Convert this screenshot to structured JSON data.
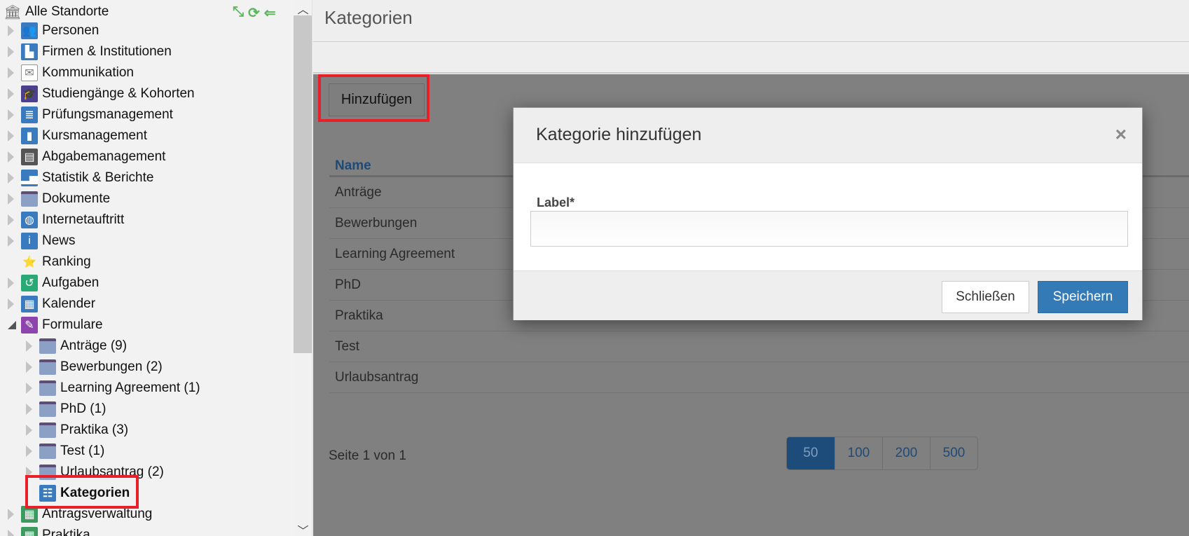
{
  "sidebar": {
    "root": "Alle Standorte",
    "items": [
      {
        "label": "Personen",
        "icon": "persons-icon",
        "color": "#3a7abf",
        "glyph": "👥",
        "level": 0,
        "arrow": "closed"
      },
      {
        "label": "Firmen & Institutionen",
        "icon": "factory-icon",
        "color": "#3a7abf",
        "glyph": "▙",
        "level": 0,
        "arrow": "closed"
      },
      {
        "label": "Kommunikation",
        "icon": "envelope-icon",
        "color": "#ffffff",
        "glyph": "✉",
        "level": 0,
        "arrow": "closed"
      },
      {
        "label": "Studiengänge & Kohorten",
        "icon": "graduation-cap-icon",
        "color": "#4b3f8f",
        "glyph": "🎓",
        "level": 0,
        "arrow": "closed"
      },
      {
        "label": "Prüfungsmanagement",
        "icon": "exam-chart-icon",
        "color": "#3a7abf",
        "glyph": "≣",
        "level": 0,
        "arrow": "closed"
      },
      {
        "label": "Kursmanagement",
        "icon": "book-icon",
        "color": "#3a7abf",
        "glyph": "▮",
        "level": 0,
        "arrow": "closed"
      },
      {
        "label": "Abgabemanagement",
        "icon": "id-card-icon",
        "color": "#555555",
        "glyph": "▤",
        "level": 0,
        "arrow": "closed"
      },
      {
        "label": "Statistik & Berichte",
        "icon": "bar-chart-icon",
        "color": "#3a7abf",
        "glyph": "▂▅",
        "level": 0,
        "arrow": "closed"
      },
      {
        "label": "Dokumente",
        "icon": "folder-icon",
        "color": "#8c9fc4",
        "glyph": "",
        "level": 0,
        "arrow": "closed",
        "folder": true
      },
      {
        "label": "Internetauftritt",
        "icon": "globe-icon",
        "color": "#3a7abf",
        "glyph": "◍",
        "level": 0,
        "arrow": "closed"
      },
      {
        "label": "News",
        "icon": "info-icon",
        "color": "#3a7abf",
        "glyph": "i",
        "level": 0,
        "arrow": "closed"
      },
      {
        "label": "Ranking",
        "icon": "star-medal-icon",
        "color": "#f2f2f2",
        "glyph": "⭐",
        "level": 0,
        "arrow": "none"
      },
      {
        "label": "Aufgaben",
        "icon": "history-clock-icon",
        "color": "#2aa876",
        "glyph": "↺",
        "level": 0,
        "arrow": "closed"
      },
      {
        "label": "Kalender",
        "icon": "calendar-icon",
        "color": "#3a7abf",
        "glyph": "▦",
        "level": 0,
        "arrow": "closed"
      },
      {
        "label": "Formulare",
        "icon": "form-wand-icon",
        "color": "#8e44ad",
        "glyph": "✎",
        "level": 0,
        "arrow": "open"
      },
      {
        "label": "Anträge (9)",
        "icon": "folder-icon",
        "level": 1,
        "arrow": "closed",
        "folder": true
      },
      {
        "label": "Bewerbungen (2)",
        "icon": "folder-icon",
        "level": 1,
        "arrow": "closed",
        "folder": true
      },
      {
        "label": "Learning Agreement (1)",
        "icon": "folder-icon",
        "level": 1,
        "arrow": "closed",
        "folder": true
      },
      {
        "label": "PhD (1)",
        "icon": "folder-icon",
        "level": 1,
        "arrow": "closed",
        "folder": true
      },
      {
        "label": "Praktika (3)",
        "icon": "folder-icon",
        "level": 1,
        "arrow": "closed",
        "folder": true
      },
      {
        "label": "Test (1)",
        "icon": "folder-icon",
        "level": 1,
        "arrow": "closed",
        "folder": true
      },
      {
        "label": "Urlaubsantrag (2)",
        "icon": "folder-icon",
        "level": 1,
        "arrow": "closed",
        "folder": true
      },
      {
        "label": "Kategorien",
        "icon": "hierarchy-icon",
        "color": "#3a7abf",
        "glyph": "☷",
        "level": 1,
        "arrow": "none",
        "bold": true
      },
      {
        "label": "Antragsverwaltung",
        "icon": "table-user-icon",
        "color": "#3c9a5f",
        "glyph": "▦",
        "level": 0,
        "arrow": "closed"
      },
      {
        "label": "Praktika",
        "icon": "table-icon",
        "color": "#3c9a5f",
        "glyph": "▦",
        "level": 0,
        "arrow": "closed"
      }
    ]
  },
  "header": {
    "title": "Kategorien"
  },
  "toolbar": {
    "add_label": "Hinzufügen"
  },
  "table": {
    "column": "Name",
    "rows": [
      "Anträge",
      "Bewerbungen",
      "Learning Agreement",
      "PhD",
      "Praktika",
      "Test",
      "Urlaubsantrag"
    ]
  },
  "pagination": {
    "info": "Seite 1 von 1",
    "sizes": [
      "50",
      "100",
      "200",
      "500"
    ],
    "active": "50"
  },
  "modal": {
    "title": "Kategorie hinzufügen",
    "close_glyph": "×",
    "field_label": "Label*",
    "field_value": "",
    "close_label": "Schließen",
    "save_label": "Speichern"
  },
  "colors": {
    "primary": "#337ab7",
    "highlight": "#e8202a",
    "link": "#1e4a78"
  }
}
